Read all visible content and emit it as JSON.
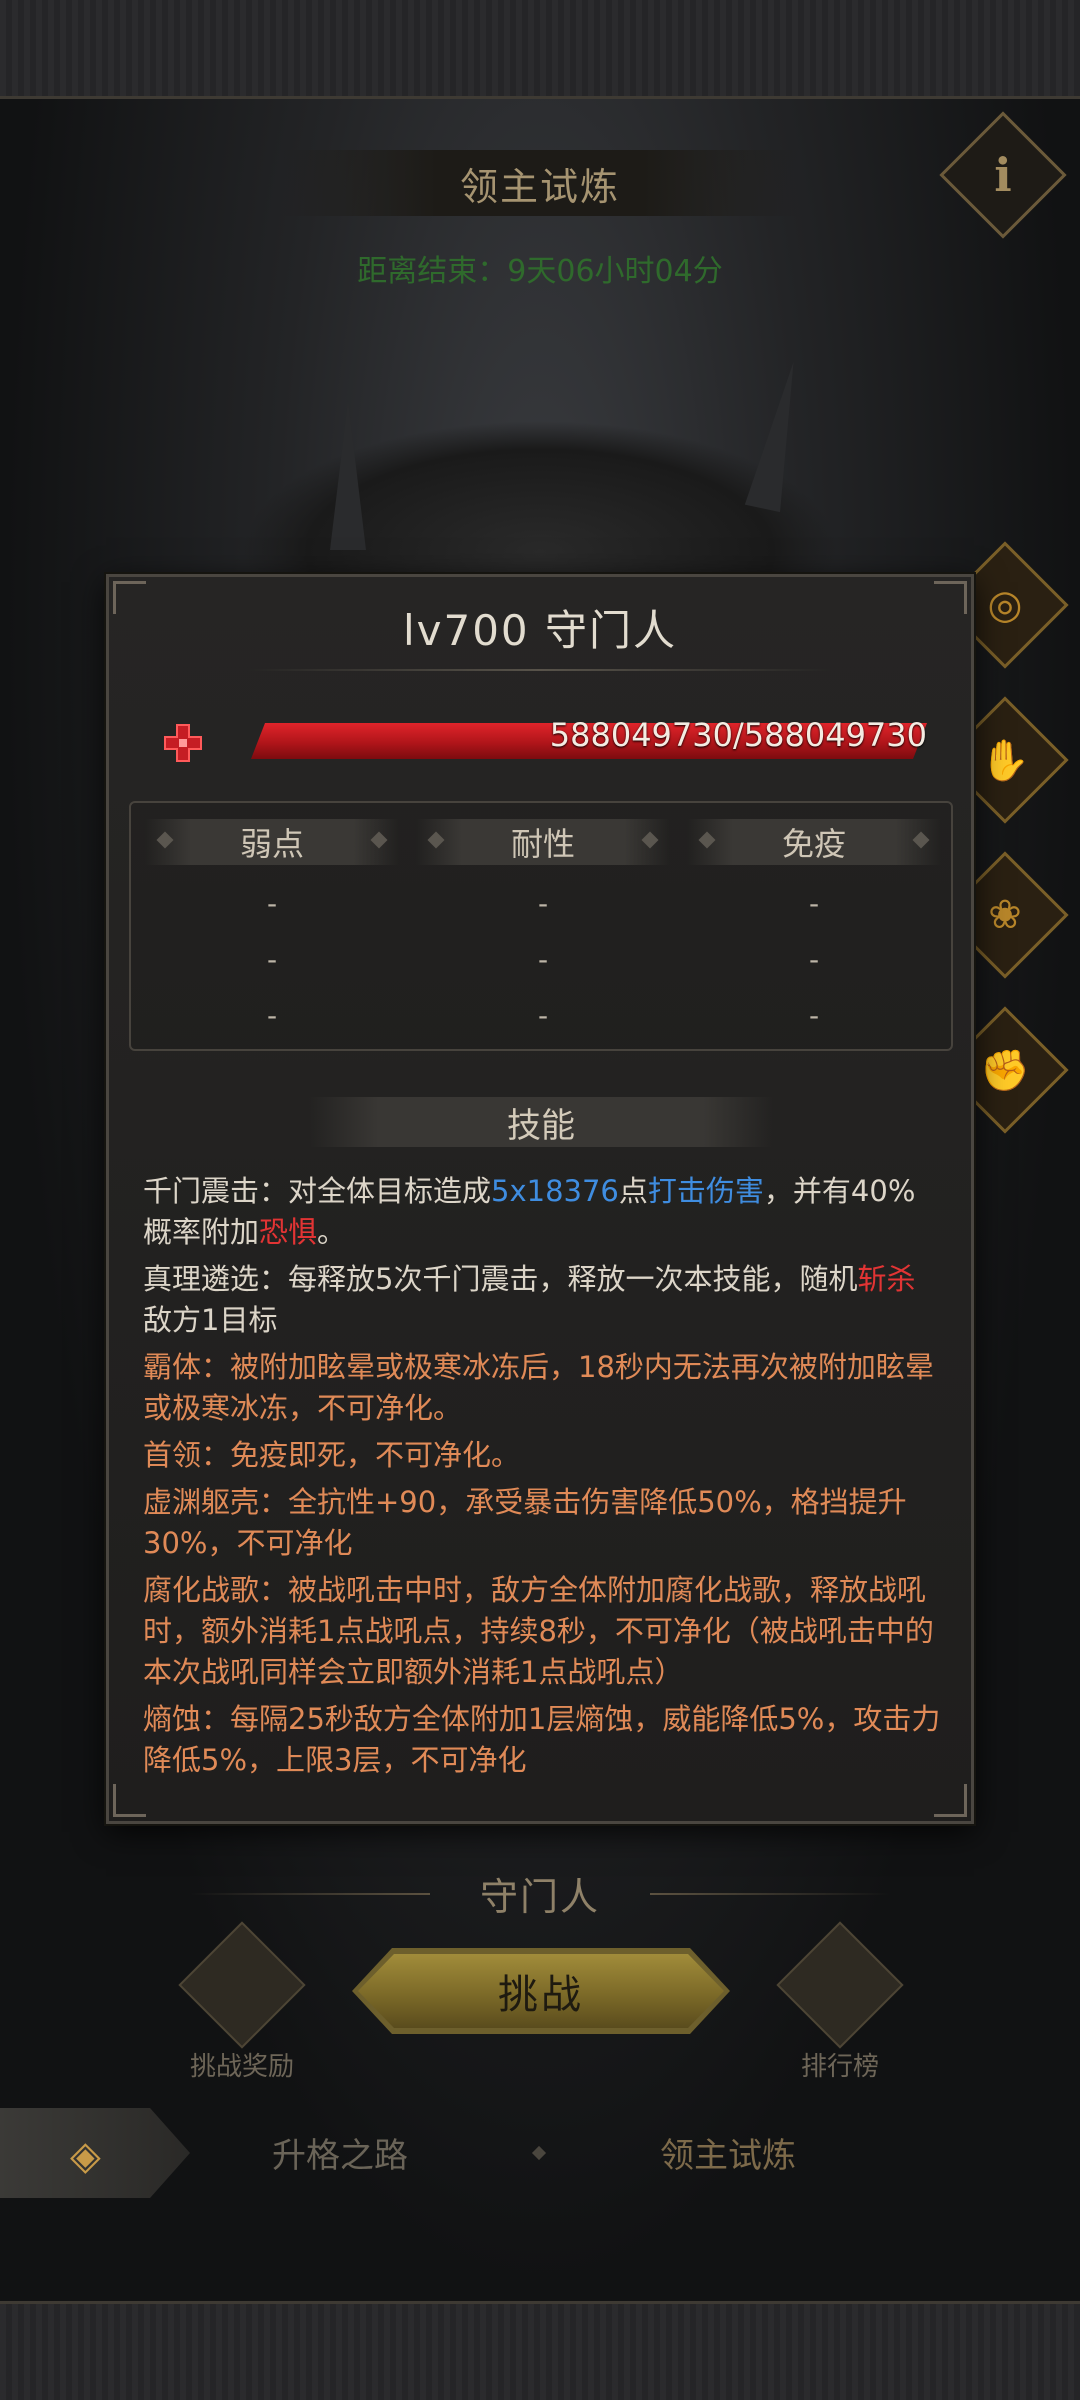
{
  "header": {
    "title": "领主试炼",
    "info_label": "i",
    "countdown": "距离结束：9天06小时04分"
  },
  "boss_panel": {
    "title": "lv700  守门人",
    "hp_text": "588049730/588049730",
    "hp_current": 588049730,
    "hp_max": 588049730,
    "resist_columns": [
      {
        "label": "弱点",
        "values": [
          "-",
          "-",
          "-"
        ]
      },
      {
        "label": "耐性",
        "values": [
          "-",
          "-",
          "-"
        ]
      },
      {
        "label": "免疫",
        "values": [
          "-",
          "-",
          "-"
        ]
      }
    ],
    "skill_header": "技能",
    "skills": {
      "s1": {
        "a": "千门震击：对全体目标造成",
        "b": "5x18376",
        "c": "点",
        "d": "打击伤害",
        "e": "，并有40%概率附加",
        "f": "恐惧",
        "g": "。"
      },
      "s2": {
        "a": "真理遴选：每释放5次千门震击，释放一次本技能，随机",
        "b": "斩杀",
        "c": "敌方1目标"
      },
      "s3": "霸体：被附加眩晕或极寒冰冻后，18秒内无法再次被附加眩晕或极寒冰冻，不可净化。",
      "s4": "首领：免疫即死，不可净化。",
      "s5": "虚渊躯壳：全抗性+90，承受暴击伤害降低50%，格挡提升30%，不可净化",
      "s6": "腐化战歌：被战吼击中时，敌方全体附加腐化战歌，释放战吼时，额外消耗1点战吼点，持续8秒，不可净化（被战吼击中的本次战吼同样会立即额外消耗1点战吼点）",
      "s7": "熵蚀：每隔25秒敌方全体附加1层熵蚀，威能降低5%，攻击力降低5%，上限3层，不可净化"
    }
  },
  "footer": {
    "boss_name": "守门人",
    "reward_label": "挑战奖励",
    "challenge_label": "挑战",
    "rank_label": "排行榜",
    "back_icon": "◈",
    "tabs": [
      "升格之路",
      "领主试炼"
    ]
  },
  "colors": {
    "hp_red": "#c8181d",
    "highlight_blue": "#3f8de0",
    "highlight_red": "#e23434",
    "orange_text": "#e08a57",
    "gold": "#a18c3a"
  }
}
